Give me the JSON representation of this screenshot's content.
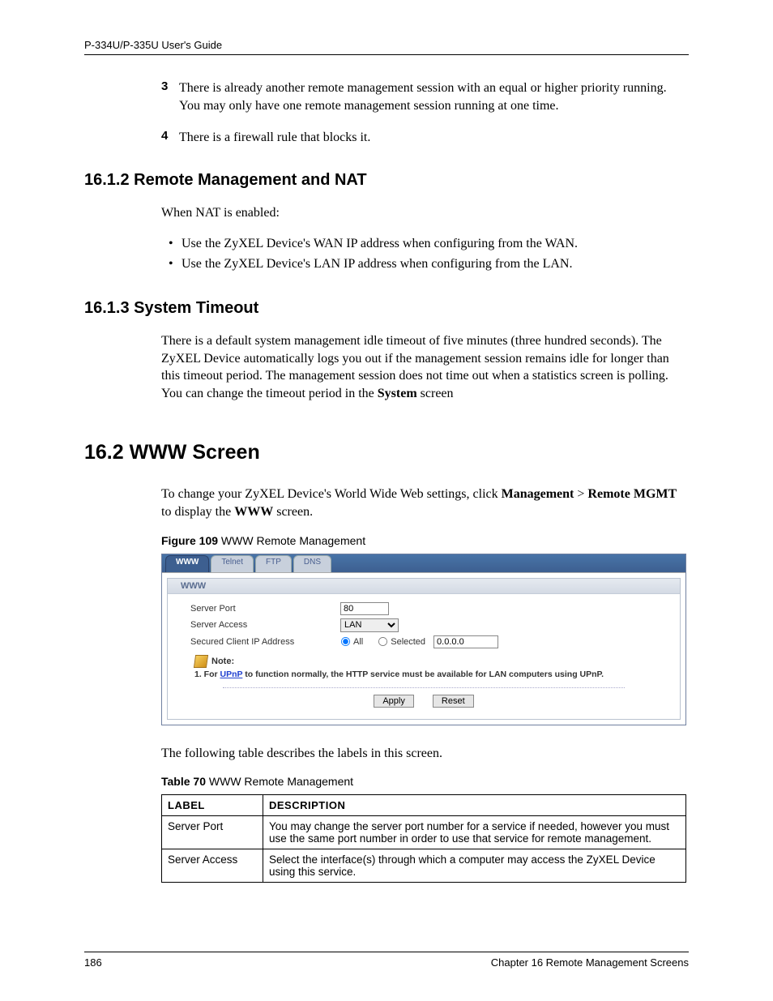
{
  "header_left": "P-334U/P-335U User's Guide",
  "list3_marker": "3",
  "list3_text": "There is already another remote management session with an equal or higher priority running. You may only have one remote management session running at one time.",
  "list4_marker": "4",
  "list4_text": "There is a firewall rule that blocks it.",
  "sec_1612_title": "16.1.2  Remote Management and NAT",
  "sec_1612_intro": "When NAT is enabled:",
  "bul1": "Use the ZyXEL Device's WAN IP address when configuring from the WAN.",
  "bul2": "Use the ZyXEL Device's LAN IP address when configuring from the LAN.",
  "sec_1613_title": "16.1.3  System Timeout",
  "sec_1613_body_a": "There is a default system management idle timeout of five minutes (three hundred seconds). The ZyXEL Device automatically logs you out if the management session remains idle for longer than this timeout period. The management session does not time out when a statistics screen is polling. You can change the timeout period in the ",
  "sec_1613_body_b_bold": "System",
  "sec_1613_body_c": " screen",
  "sec_162_title": "16.2  WWW Screen",
  "sec_162_body_a": "To change your ZyXEL Device's World Wide Web settings, click ",
  "sec_162_body_b_bold": "Management",
  "sec_162_body_c": " > ",
  "sec_162_body_d_bold": "Remote MGMT",
  "sec_162_body_e": " to display the ",
  "sec_162_body_f_bold": "WWW",
  "sec_162_body_g": " screen.",
  "fig_num": "Figure 109",
  "fig_title": "   WWW Remote Management",
  "tabs": {
    "www": "WWW",
    "telnet": "Telnet",
    "ftp": "FTP",
    "dns": "DNS"
  },
  "panel_title": "WWW",
  "form": {
    "server_port_label": "Server Port",
    "server_port_value": "80",
    "server_access_label": "Server Access",
    "server_access_value": "LAN",
    "secured_ip_label": "Secured Client IP Address",
    "radio_all": "All",
    "radio_selected": "Selected",
    "secured_ip_value": "0.0.0.0"
  },
  "note_label": "Note:",
  "note_body_a": "1. For ",
  "note_body_link": "UPnP",
  "note_body_b": " to function normally, the HTTP service must be available for LAN computers using UPnP.",
  "btn_apply": "Apply",
  "btn_reset": "Reset",
  "after_fig": "The following table describes the labels in this screen.",
  "tbl_num": "Table 70",
  "tbl_title": "   WWW Remote Management",
  "tbl_h1": "LABEL",
  "tbl_h2": "DESCRIPTION",
  "tbl_r1c1": "Server Port",
  "tbl_r1c2": "You may change the server port number for a service if needed, however you must use the same port number in order to use that service for remote management.",
  "tbl_r2c1": "Server Access",
  "tbl_r2c2": "Select the interface(s) through which a computer may access the ZyXEL Device using this service.",
  "footer_page": "186",
  "footer_chapter": "Chapter 16 Remote Management Screens"
}
